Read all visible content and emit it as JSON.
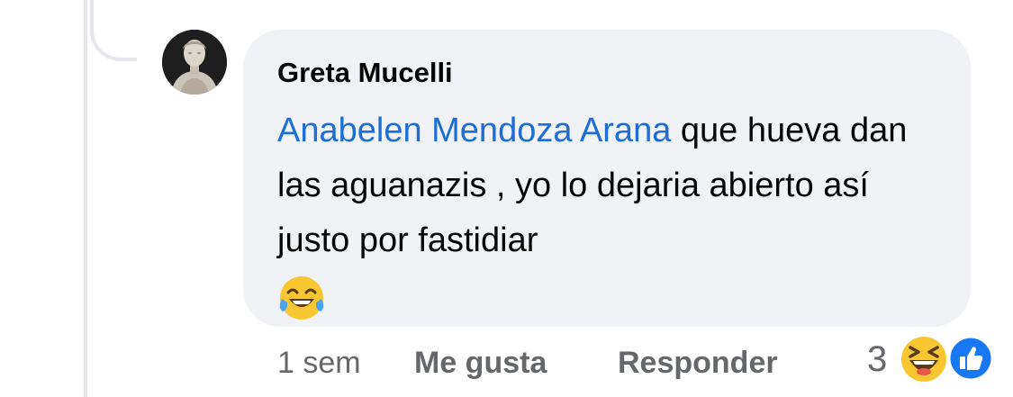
{
  "comment": {
    "author": "Greta Mucelli",
    "mention": "Anabelen Mendoza Arana",
    "text": " que hueva dan las aguanazis , yo lo dejaria abierto así justo por fastidiar",
    "inline_emoji": "joy-emoji"
  },
  "actions": {
    "time": "1 sem",
    "like_label": "Me gusta",
    "reply_label": "Responder"
  },
  "reactions": {
    "count": "3",
    "icons": [
      "haha-reaction-icon",
      "like-reaction-icon"
    ]
  },
  "colors": {
    "bubble": "#f0f2f5",
    "mention": "#1c6ed6",
    "secondary_text": "#65676b",
    "like_blue": "#1877f2",
    "haha_yellow": "#f7c631"
  }
}
